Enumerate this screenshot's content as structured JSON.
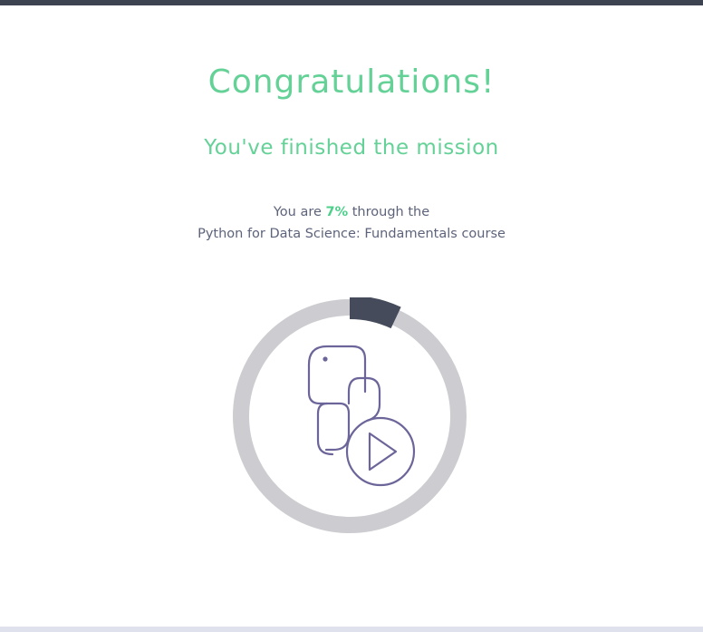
{
  "header": {
    "title": "Congratulations!",
    "subtitle": "You've finished the mission"
  },
  "progress": {
    "prefix": "You are ",
    "percent_text": "7%",
    "suffix": " through the",
    "course_line": "Python for Data Science: Fundamentals course",
    "fraction": 0.07
  },
  "icon": "python-play-icon",
  "colors": {
    "accent": "#64d197",
    "ring_track": "#cdcdd1",
    "ring_fill": "#454b5a",
    "icon_stroke": "#6b6599",
    "text": "#5d637a"
  }
}
